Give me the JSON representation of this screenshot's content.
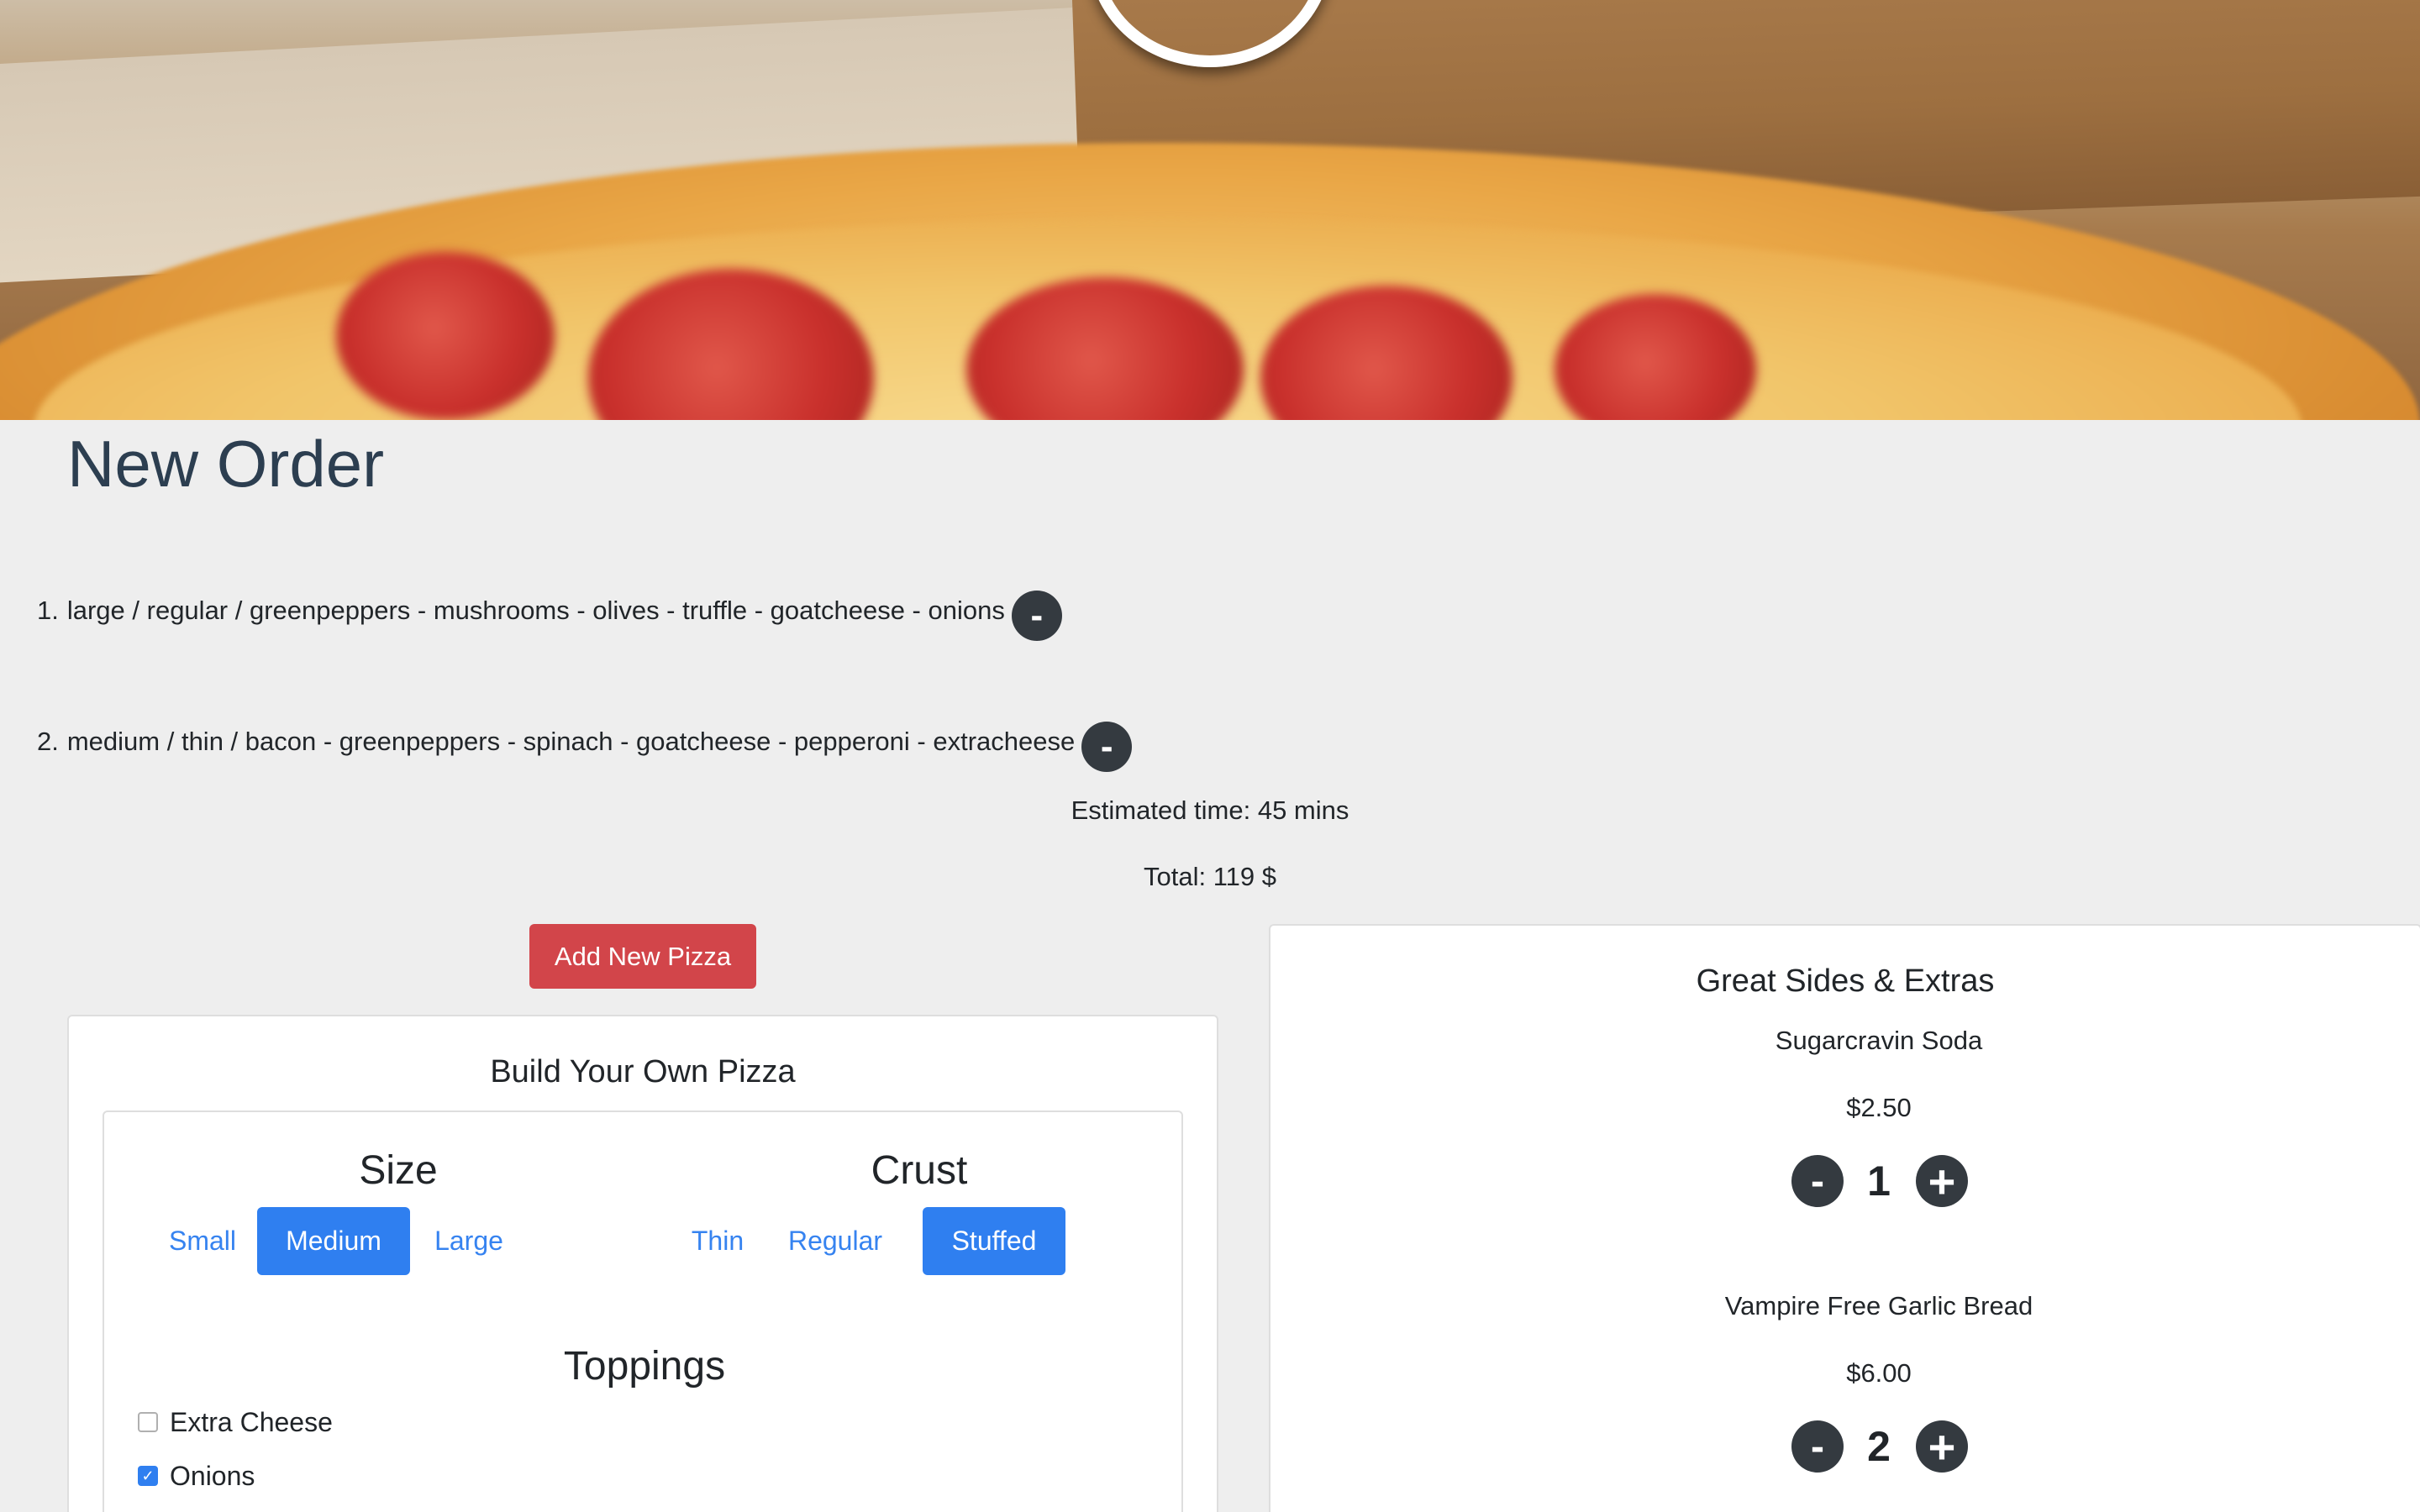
{
  "page_title": "New Order",
  "order": {
    "items": [
      {
        "number": "1.",
        "text": "large / regular / greenpeppers - mushrooms - olives - truffle - goatcheese - onions",
        "remove_label": "-"
      },
      {
        "number": "2.",
        "text": "medium / thin / bacon - greenpeppers - spinach - goatcheese - pepperoni - extracheese",
        "remove_label": "-"
      }
    ],
    "estimated_time": "Estimated time: 45 mins",
    "total": "Total: 119 $",
    "add_button": "Add New Pizza"
  },
  "builder": {
    "title": "Build Your Own Pizza",
    "size": {
      "title": "Size",
      "options": [
        "Small",
        "Medium",
        "Large"
      ],
      "selected": "Medium"
    },
    "crust": {
      "title": "Crust",
      "options": [
        "Thin",
        "Regular",
        "Stuffed"
      ],
      "selected": "Stuffed"
    },
    "toppings": {
      "title": "Toppings",
      "items": [
        {
          "label": "Extra Cheese",
          "checked": false
        },
        {
          "label": "Onions",
          "checked": true
        }
      ]
    }
  },
  "sides": {
    "title": "Great Sides & Extras",
    "items": [
      {
        "name": "Sugarcravin Soda",
        "price": "$2.50",
        "quantity": "1",
        "minus": "-",
        "plus": "+"
      },
      {
        "name": "Vampire Free Garlic Bread",
        "price": "$6.00",
        "quantity": "2",
        "minus": "-",
        "plus": "+"
      }
    ]
  },
  "colors": {
    "primary": "#2f7ff0",
    "danger": "#d2454a",
    "dark_button": "#343a40",
    "title": "#2c3e50",
    "background": "#eeeeee"
  },
  "icons": {
    "remove": "minus-circle-icon",
    "increment": "plus-circle-icon",
    "decrement": "minus-circle-icon"
  }
}
